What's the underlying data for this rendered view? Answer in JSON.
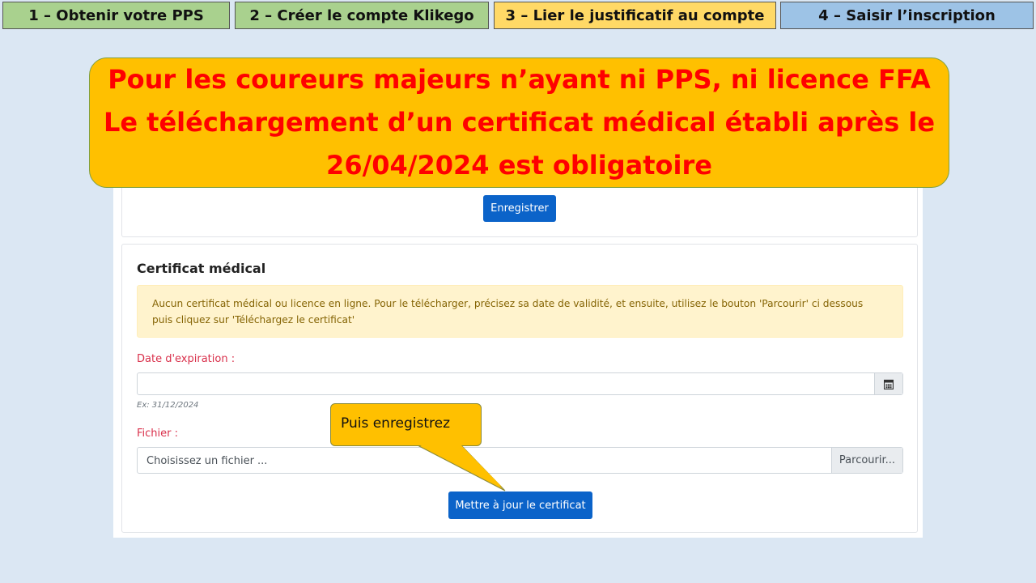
{
  "steps": [
    {
      "label": "1 – Obtenir votre PPS",
      "color": "#a9d18e"
    },
    {
      "label": "2 – Créer le compte Klikego",
      "color": "#a9d18e"
    },
    {
      "label": "3 – Lier le justificatif au compte",
      "color": "#ffd966"
    },
    {
      "label": "4 – Saisir l’inscription",
      "color": "#9dc3e6"
    }
  ],
  "banner": {
    "lines": [
      "Pour les coureurs majeurs n’ayant ni PPS, ni licence FFA",
      "Le téléchargement d’un certificat médical établi après le",
      "26/04/2024 est obligatoire"
    ],
    "text_color": "#ff0000",
    "bg_color": "#ffc000"
  },
  "top_panel": {
    "save_label": "Enregistrer"
  },
  "certificate": {
    "title": "Certificat médical",
    "alert_line1": "Aucun certificat médical ou licence en ligne. Pour le télécharger, précisez sa date de validité, et ensuite, utilisez le bouton 'Parcourir' ci dessous",
    "alert_line2": "puis cliquez sur 'Téléchargez le certificat'",
    "date_label": "Date d'expiration :",
    "date_value": "",
    "date_hint": "Ex: 31/12/2024",
    "calendar_icon": "calendar-icon",
    "file_label": "Fichier :",
    "file_placeholder": "Choisissez un fichier ...",
    "browse_label": "Parcourir...",
    "update_label": "Mettre à jour le certificat"
  },
  "tip": {
    "text": "Puis enregistrez"
  },
  "colors": {
    "primary_button": "#0b63c9",
    "required_label": "#d9304b",
    "alert_bg": "#fff3cd"
  }
}
